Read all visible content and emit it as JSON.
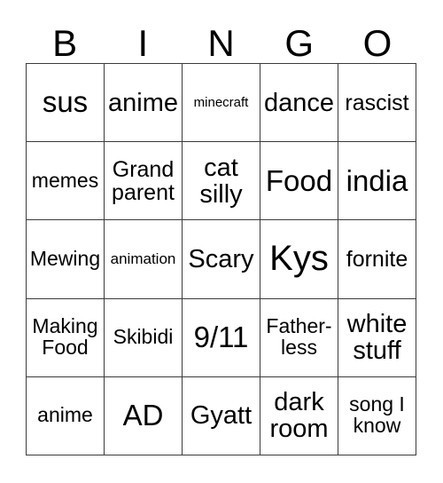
{
  "card": {
    "header": {
      "letters": [
        "B",
        "I",
        "N",
        "G",
        "O"
      ]
    },
    "grid": {
      "rows": 5,
      "columns": 5,
      "border_color": "#3b3b3b",
      "background_color": "#ffffff",
      "text_color": "#000000",
      "cells": [
        {
          "text": "sus",
          "size": "xl"
        },
        {
          "text": "anime",
          "size": "l"
        },
        {
          "text": "minecraft",
          "size": "xs"
        },
        {
          "text": "dance",
          "size": "l"
        },
        {
          "text": "rascist",
          "size": "ml"
        },
        {
          "text": "memes",
          "size": "m"
        },
        {
          "text": "Grand\nparent",
          "size": "ml"
        },
        {
          "text": "cat\nsilly",
          "size": "l"
        },
        {
          "text": "Food",
          "size": "xl"
        },
        {
          "text": "india",
          "size": "xl"
        },
        {
          "text": "Mewing",
          "size": "m"
        },
        {
          "text": "animation",
          "size": "s"
        },
        {
          "text": "Scary",
          "size": "l"
        },
        {
          "text": "Kys",
          "size": "xxl"
        },
        {
          "text": "fornite",
          "size": "ml"
        },
        {
          "text": "Making\nFood",
          "size": "m"
        },
        {
          "text": "Skibidi",
          "size": "m"
        },
        {
          "text": "9/11",
          "size": "xl"
        },
        {
          "text": "Father-\nless",
          "size": "m"
        },
        {
          "text": "white\nstuff",
          "size": "l"
        },
        {
          "text": "anime",
          "size": "m"
        },
        {
          "text": "AD",
          "size": "xl"
        },
        {
          "text": "Gyatt",
          "size": "l"
        },
        {
          "text": "dark\nroom",
          "size": "l"
        },
        {
          "text": "song I\nknow",
          "size": "m"
        }
      ]
    }
  }
}
